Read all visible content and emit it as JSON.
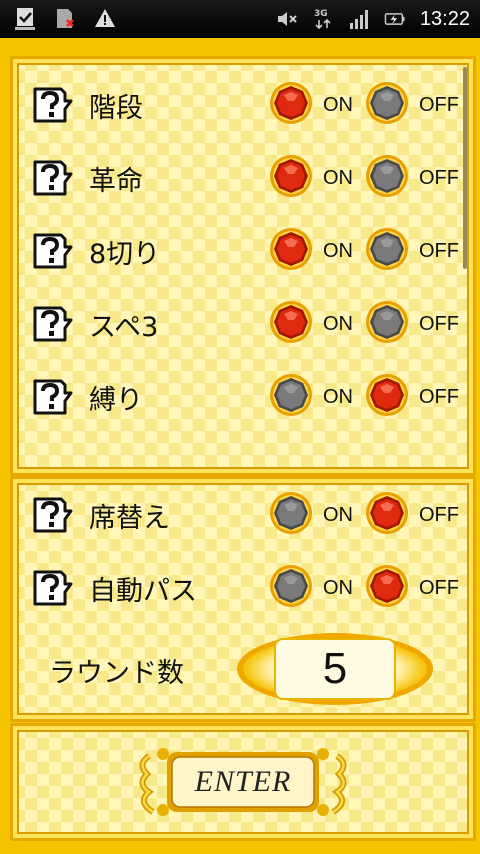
{
  "status_bar": {
    "time": "13:22",
    "network": "3G"
  },
  "rules": [
    {
      "label": "階段",
      "on": "ON",
      "off": "OFF",
      "state": "on"
    },
    {
      "label": "革命",
      "on": "ON",
      "off": "OFF",
      "state": "on"
    },
    {
      "label": "8切り",
      "on": "ON",
      "off": "OFF",
      "state": "on"
    },
    {
      "label": "スペ3",
      "on": "ON",
      "off": "OFF",
      "state": "on"
    },
    {
      "label": "縛り",
      "on": "ON",
      "off": "OFF",
      "state": "off"
    }
  ],
  "options": [
    {
      "label": "席替え",
      "on": "ON",
      "off": "OFF",
      "state": "off"
    },
    {
      "label": "自動パス",
      "on": "ON",
      "off": "OFF",
      "state": "off"
    }
  ],
  "round": {
    "label": "ラウンド数",
    "value": "5"
  },
  "enter_label": "ENTER",
  "colors": {
    "background": "#f5c400",
    "gem_selected": "#e02a10",
    "gem_unselected": "#7a7a7a"
  }
}
